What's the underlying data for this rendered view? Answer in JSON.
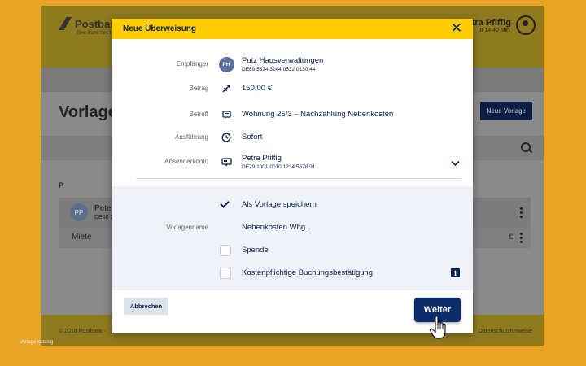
{
  "app": {
    "brand": "Postbank",
    "brand_sub": "Eine Bank fürs Leben",
    "user_name": "Petra Pfiffig",
    "user_session": "in 14:40 Min.",
    "page_title": "Vorlage",
    "new_template_button": "Neue Vorlage",
    "group_letter": "P",
    "rows": [
      {
        "avatar": "PP",
        "name": "Peter",
        "iban": "DE60 2"
      },
      {
        "name": "Miete",
        "amount": "€"
      }
    ],
    "footer_left": "© 2018 Postbank -",
    "footer_right": "Datenschutzhinweise"
  },
  "caption": "Vorlage katalog",
  "modal": {
    "title": "Neue Überweisung",
    "close_icon": "close-icon",
    "recipient_label": "Empfänger",
    "recipient_initials": "PH",
    "recipient_name": "Putz Hausverwaltungen",
    "recipient_iban": "DE89 5324 3244 0532 0130 44",
    "amount_label": "Betrag",
    "amount_value": "150,00 €",
    "reference_label": "Betreff",
    "reference_value": "Wohnung 25/3 – Nachzahlung Nebenkosten",
    "execution_label": "Ausführung",
    "execution_value": "Sofort",
    "sender_label": "Absenderkonto",
    "sender_name": "Petra Pfiffig",
    "sender_iban": "DE79 1001 0010 1234 5678 91",
    "save_template_label": "Als Vorlage speichern",
    "save_template_checked": true,
    "template_name_label": "Vorlagenname",
    "template_name_value": "Nebenkosten Whg.",
    "donation_label": "Spende",
    "donation_checked": false,
    "booking_confirm_label": "Kostenpflichtige Buchungsbestätigung",
    "booking_confirm_checked": false,
    "cancel_button": "Abbrechen",
    "next_button": "Weiter"
  },
  "colors": {
    "accent": "#ffcc00",
    "primary": "#0a2c6b",
    "text": "#0a2450"
  }
}
